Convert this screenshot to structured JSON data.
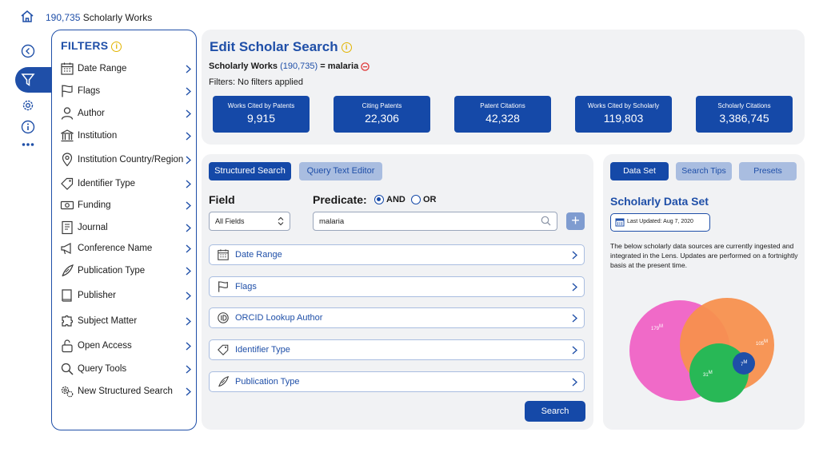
{
  "top_bar": {
    "count": "190,735",
    "label": "Scholarly Works",
    "icon": "home-icon"
  },
  "rail": {
    "icons": [
      "back-arrow-icon",
      "filter-icon",
      "gear-icon",
      "info-icon",
      "more-dots-icon"
    ],
    "active": "filter-icon"
  },
  "filters": {
    "title": "FILTERS",
    "items": [
      {
        "label": "Date Range",
        "icon": "calendar-icon"
      },
      {
        "label": "Flags",
        "icon": "flag-icon"
      },
      {
        "label": "Author",
        "icon": "person-icon"
      },
      {
        "label": "Institution",
        "icon": "building-icon"
      },
      {
        "label": "Institution Country/Region",
        "icon": "map-pin-icon"
      },
      {
        "label": "Identifier Type",
        "icon": "tag-icon"
      },
      {
        "label": "Funding",
        "icon": "money-icon"
      },
      {
        "label": "Journal",
        "icon": "journal-icon"
      },
      {
        "label": "Conference Name",
        "icon": "megaphone-icon"
      },
      {
        "label": "Publication Type",
        "icon": "quill-icon"
      },
      {
        "label": "Publisher",
        "icon": "book-icon"
      },
      {
        "label": "Subject Matter",
        "icon": "puzzle-icon"
      },
      {
        "label": "Open Access",
        "icon": "unlock-icon"
      },
      {
        "label": "Query Tools",
        "icon": "magnifier-icon"
      },
      {
        "label": "New Structured Search",
        "icon": "gears-icon"
      }
    ]
  },
  "edit": {
    "title": "Edit Scholar Search",
    "query_prefix": "Scholarly Works",
    "query_count": "(190,735)",
    "query_suffix": "= malaria",
    "filters_text": "Filters: No filters applied",
    "stats": [
      {
        "label": "Works Cited by Patents",
        "value": "9,915"
      },
      {
        "label": "Citing Patents",
        "value": "22,306"
      },
      {
        "label": "Patent Citations",
        "value": "42,328"
      },
      {
        "label": "Works Cited by Scholarly",
        "value": "119,803"
      },
      {
        "label": "Scholarly Citations",
        "value": "3,386,745"
      }
    ]
  },
  "search": {
    "tab_structured": "Structured Search",
    "tab_query": "Query Text Editor",
    "field_label": "Field",
    "predicate_label": "Predicate:",
    "and_label": "AND",
    "or_label": "OR",
    "field_select": "All Fields",
    "query_value": "malaria",
    "add_label": "+",
    "rows": [
      {
        "label": "Date Range",
        "icon": "calendar-icon"
      },
      {
        "label": "Flags",
        "icon": "flag-icon"
      },
      {
        "label": "ORCID Lookup Author",
        "icon": "orcid-icon"
      },
      {
        "label": "Identifier Type",
        "icon": "tag-icon"
      },
      {
        "label": "Publication Type",
        "icon": "quill-icon"
      }
    ],
    "search_button": "Search"
  },
  "dataset": {
    "tab_dataset": "Data Set",
    "tab_tips": "Search Tips",
    "tab_presets": "Presets",
    "title": "Scholarly Data Set",
    "updated": "Last Updated: Aug 7, 2020",
    "description": "The below scholarly data sources are currently ingested and integrated in the Lens. Updates are performed on a fortnightly basis at the present time.",
    "venn_labels": [
      "179",
      "105",
      "31",
      "7"
    ],
    "venn_unit": "M",
    "colors": {
      "pink": "#f06ac8",
      "orange": "#f7904e",
      "green": "#28b856",
      "blue": "#1f4fa8"
    }
  }
}
